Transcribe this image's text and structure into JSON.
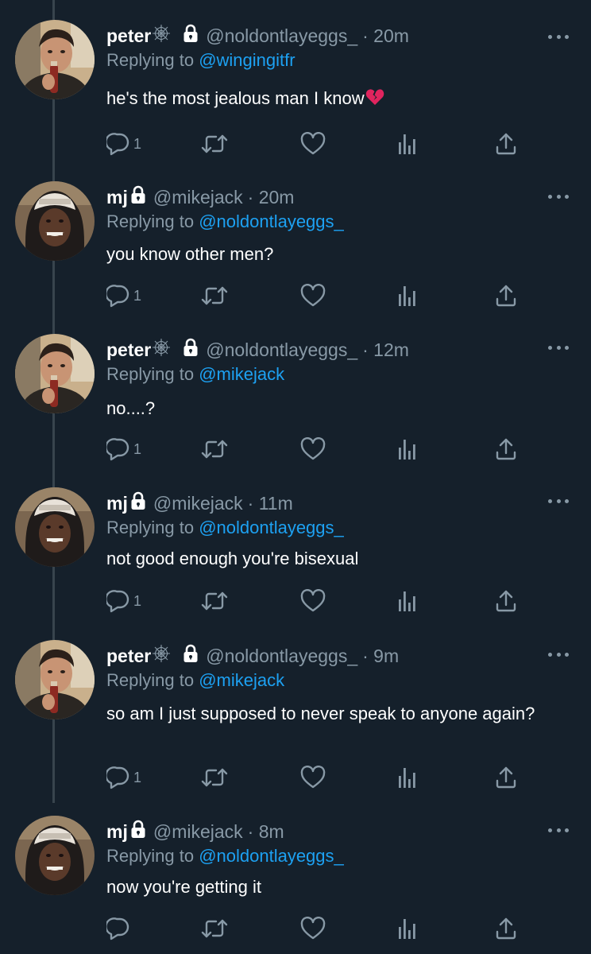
{
  "tweets": [
    {
      "name": "peter",
      "name_icon": "spider-web-icon",
      "locked": true,
      "handle": "@noldontlayeggs_",
      "time": "· 20m",
      "replying_prefix": "Replying to ",
      "replying_to": "@wingingitfr",
      "text": "he's the most jealous man I know",
      "text_emoji": "broken-heart-icon",
      "reply_count": "1",
      "avatar": "peter"
    },
    {
      "name": "mj",
      "name_icon": "",
      "locked": true,
      "handle": "@mikejack",
      "time": "· 20m",
      "replying_prefix": "Replying to ",
      "replying_to": "@noldontlayeggs_",
      "text": "you know other men?",
      "text_emoji": "",
      "reply_count": "1",
      "avatar": "mj"
    },
    {
      "name": "peter",
      "name_icon": "spider-web-icon",
      "locked": true,
      "handle": "@noldontlayeggs_",
      "time": "· 12m",
      "replying_prefix": "Replying to ",
      "replying_to": "@mikejack",
      "text": "no....?",
      "text_emoji": "",
      "reply_count": "1",
      "avatar": "peter"
    },
    {
      "name": "mj",
      "name_icon": "",
      "locked": true,
      "handle": "@mikejack",
      "time": "· 11m",
      "replying_prefix": "Replying to ",
      "replying_to": "@noldontlayeggs_",
      "text": "not good enough you're bisexual",
      "text_emoji": "",
      "reply_count": "1",
      "avatar": "mj"
    },
    {
      "name": "peter",
      "name_icon": "spider-web-icon",
      "locked": true,
      "handle": "@noldontlayeggs_",
      "time": "· 9m",
      "replying_prefix": "Replying to ",
      "replying_to": "@mikejack",
      "text": "so am I just supposed to never speak to anyone again?",
      "text_emoji": "",
      "reply_count": "1",
      "avatar": "peter"
    },
    {
      "name": "mj",
      "name_icon": "",
      "locked": true,
      "handle": "@mikejack",
      "time": "· 8m",
      "replying_prefix": "Replying to ",
      "replying_to": "@noldontlayeggs_",
      "text": "now you're getting it",
      "text_emoji": "",
      "reply_count": "",
      "avatar": "mj"
    }
  ],
  "action_icons": [
    "reply-icon",
    "retweet-icon",
    "like-icon",
    "analytics-icon",
    "share-icon"
  ],
  "colors": {
    "background": "#15202b",
    "text": "#ffffff",
    "muted": "#8899a6",
    "link": "#1da1f2",
    "thread_line": "#38444d",
    "heart": "#e0245e"
  }
}
